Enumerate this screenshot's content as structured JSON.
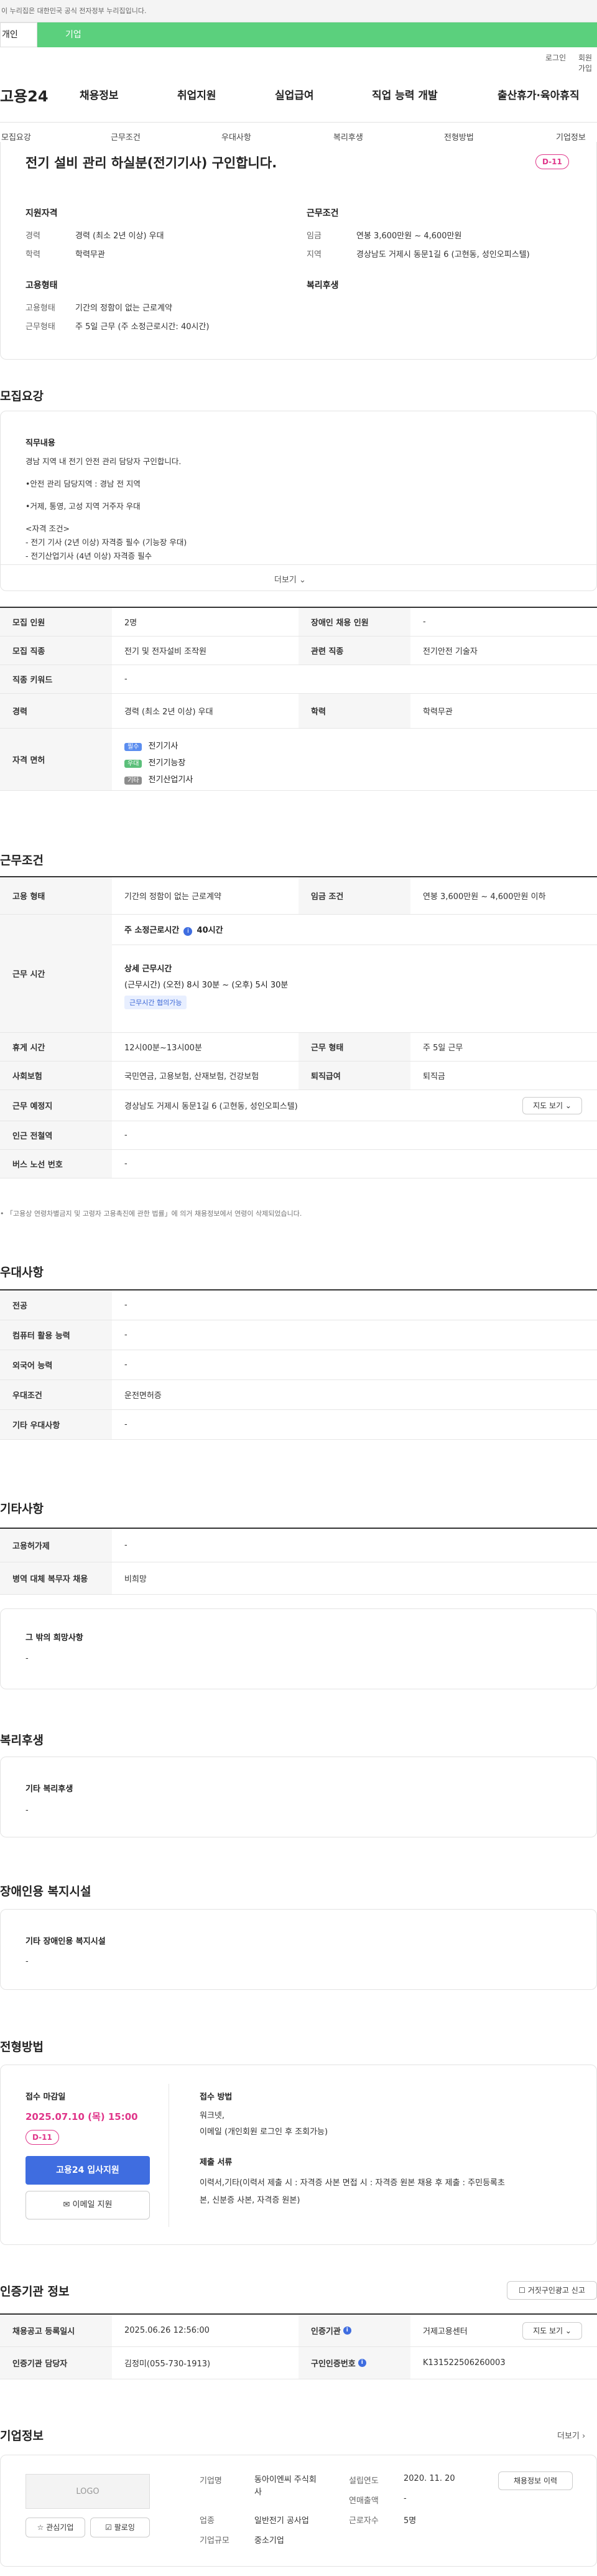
{
  "topbar": {
    "text": "이 누리집은 대한민국 공식 전자정부 누리집입니다."
  },
  "member_tabs": {
    "user": "개인",
    "corp": "기업"
  },
  "util": {
    "login": "로그인",
    "join": "회원가입"
  },
  "gnb": {
    "logo": "고용24",
    "items": [
      "채용정보",
      "취업지원",
      "실업급여",
      "직업 능력 개발",
      "출산휴가·육아휴직"
    ]
  },
  "tabbar": {
    "items": [
      "모집요강",
      "근무조건",
      "우대사항",
      "복리후생",
      "전형방법",
      "기업정보"
    ]
  },
  "summary": {
    "title": "전기 설비 관리 하실분(전기기사) 구인합니다.",
    "dday": "D-11",
    "qualification": {
      "heading": "지원자격",
      "rows": [
        {
          "label": "경력",
          "value": "경력 (최소 2년 이상) 우대"
        },
        {
          "label": "학력",
          "value": "학력무관"
        }
      ]
    },
    "conditions": {
      "heading": "근무조건",
      "rows": [
        {
          "label": "임금",
          "value": "연봉 3,600만원 ~ 4,600만원"
        },
        {
          "label": "지역",
          "value": "경상남도 거제시 동문1길 6 (고현동, 성인오피스텔)"
        }
      ]
    },
    "employment": {
      "heading": "고용형태",
      "rows": [
        {
          "label": "고용형태",
          "value": "기간의 정함이 없는 근로계약"
        },
        {
          "label": "근무형태",
          "value": "주 5일 근무 (주 소정근로시간: 40시간)"
        }
      ]
    },
    "welfare": {
      "heading": "복리후생"
    }
  },
  "recruit": {
    "section_title": "모집요강",
    "duty_heading": "직무내용",
    "duty_lines": [
      "경남 지역 내 전기 안전 관리 담당자 구인합니다.",
      "•안전 관리 담당지역 : 경남 전 지역",
      "•거제, 통영, 고성 지역 거주자 우대",
      "<자격 조건>",
      "- 전기 기사 (2년 이상) 자격증 필수 (기능장 우대)",
      "- 전기산업기사 (4년 이상) 자격증 필수"
    ],
    "more": "더보기",
    "table": {
      "headcount_label": "모집 인원",
      "headcount": "2명",
      "disabled_label": "장애인 채용 인원",
      "disabled": "-",
      "job_label": "모집 직종",
      "job": "전기 및 전자설비 조작원",
      "related_label": "관련 직종",
      "related": "전기안전 기술자",
      "keyword_label": "직종 키워드",
      "keyword": "-",
      "career_label": "경력",
      "career": "경력 (최소 2년 이상) 우대",
      "edu_label": "학력",
      "edu": "학력무관",
      "license_label": "자격 면허",
      "licenses": [
        {
          "badge": "필수",
          "name": "전기기사",
          "color": "#5b8def"
        },
        {
          "badge": "우대",
          "name": "전기기능장",
          "color": "#5bbf7a"
        },
        {
          "badge": "기타",
          "name": "전기산업기사",
          "color": "#8c8c8c"
        }
      ]
    }
  },
  "work": {
    "section_title": "근무조건",
    "type_label": "고용 형태",
    "type": "기간의 정함이 없는 근로계약",
    "wage_label": "임금 조건",
    "wage": "연봉 3,600만원 ~ 4,600만원 이하",
    "hours_label": "근무 시간",
    "weekly_label": "주 소정근로시간",
    "weekly": "40시간",
    "detail_label": "상세 근무시간",
    "detail": "(근무시간) (오전) 8시 30분 ~ (오후) 5시 30분",
    "hours_tag": "근무시간 협의가능",
    "break_label": "휴게 시간",
    "break": "12시00분~13시00분",
    "form_label": "근무 형태",
    "form": "주 5일 근무",
    "insurance_label": "사회보험",
    "insurance": "국민연금, 고용보험, 산재보험, 건강보험",
    "severance_label": "퇴직급여",
    "severance": "퇴직금",
    "place_label": "근무 예정지",
    "place": "경상남도 거제시 동문1길 6 (고현동, 성인오피스텔)",
    "map_button": "지도 보기",
    "subway_label": "인근 전철역",
    "subway": "-",
    "bus_label": "버스 노선 번호",
    "bus": "-",
    "note": "「고용상 연령차별금지 및 고령자 고용촉진에 관한 법률」에 의거 채용정보에서 연령이 삭제되었습니다."
  },
  "preference": {
    "section_title": "우대사항",
    "rows": [
      {
        "label": "전공",
        "value": "-"
      },
      {
        "label": "컴퓨터 활용 능력",
        "value": "-"
      },
      {
        "label": "외국어 능력",
        "value": "-"
      },
      {
        "label": "우대조건",
        "value": "운전면허증"
      },
      {
        "label": "기타 우대사항",
        "value": "-"
      }
    ]
  },
  "etc": {
    "section_title": "기타사항",
    "rows": [
      {
        "label": "고용허가제",
        "value": "-"
      },
      {
        "label": "병역 대체 복무자 채용",
        "value": "비희망"
      }
    ],
    "wish_heading": "그 밖의 희망사항",
    "wish_value": "-"
  },
  "welfare": {
    "section_title": "복리후생",
    "heading": "기타 복리후생",
    "value": "-"
  },
  "disabled_facility": {
    "section_title": "장애인용 복지시설",
    "heading": "기타 장애인용 복지시설",
    "value": "-"
  },
  "selection": {
    "section_title": "전형방법",
    "deadline_heading": "접수 마감일",
    "deadline": "2025.07.10 (목) 15:00",
    "dday": "D-11",
    "apply_button": "고용24 입사지원",
    "email_button": "이메일 지원",
    "method_heading": "접수 방법",
    "method_lines": [
      "워크넷,",
      "이메일 (개인회원 로그인 후 조회가능)"
    ],
    "docs_heading": "제출 서류",
    "docs_lines": [
      "이력서,기타(이력서 제출 시 : 자격증 사본  면접 시 : 자격증 원본  채용 후 제출 : 주민등록초",
      "본, 신분증 사본, 자격증 원본)"
    ]
  },
  "cert": {
    "section_title": "인증기관 정보",
    "report_button": "거짓구인광고 신고",
    "reg_label": "채용공고 등록일시",
    "reg": "2025.06.26 12:56:00",
    "org_label": "인증기관",
    "org": "거제고용센터",
    "map_button": "지도 보기",
    "manager_label": "인증기관 담당자",
    "manager": "김정미(055-730-1913)",
    "number_label": "구인인증번호",
    "number": "K131522506260003"
  },
  "company": {
    "section_title": "기업정보",
    "more": "더보기",
    "logo": "LOGO",
    "interest_button": "관심기업",
    "follow_button": "팔로잉",
    "name_label": "기업명",
    "name": "동아이엔씨 주식회사",
    "industry_label": "업종",
    "industry": "일반전기 공사업",
    "size_label": "기업규모",
    "size": "중소기업",
    "founded_label": "설립연도",
    "founded": "2020. 11. 20",
    "revenue_label": "연매출액",
    "revenue": "-",
    "employees_label": "근로자수",
    "employees": "5명",
    "jobs_button": "채용정보 이력"
  }
}
